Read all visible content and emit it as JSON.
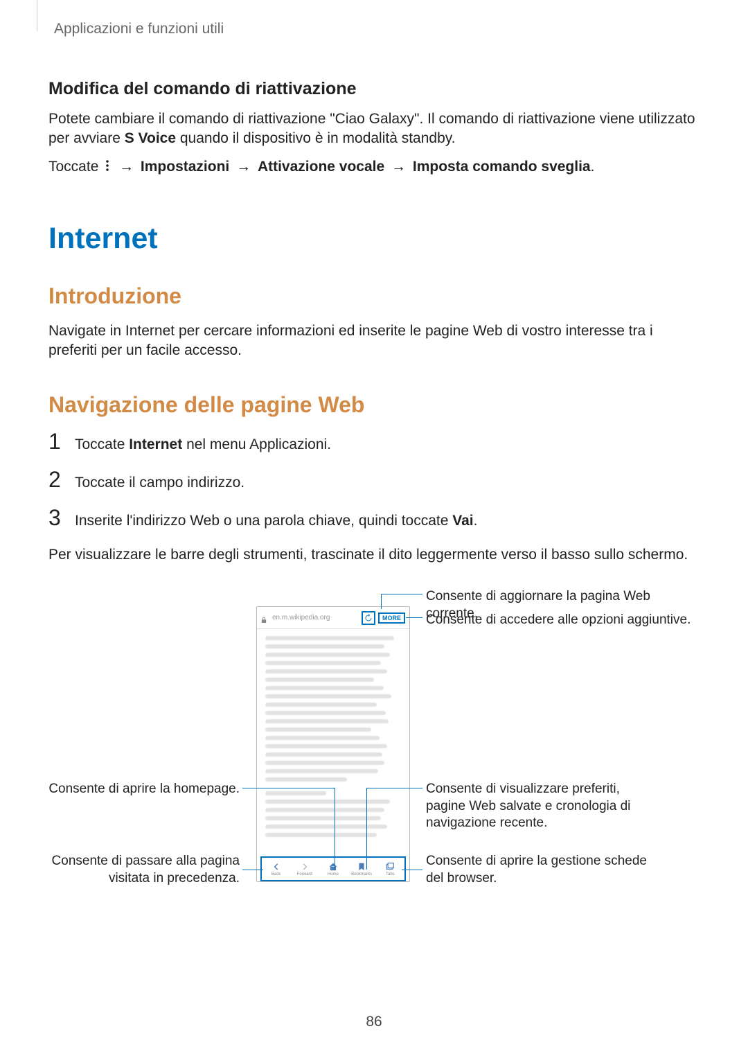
{
  "header": "Applicazioni e funzioni utili",
  "section1": {
    "title": "Modifica del comando di riattivazione",
    "p1_part1": "Potete cambiare il comando di riattivazione \"Ciao Galaxy\". Il comando di riattivazione viene utilizzato per avviare ",
    "p1_bold": "S Voice",
    "p1_part2": " quando il dispositivo è in modalità standby.",
    "p2_part1": "Toccate ",
    "p2_path1": "Impostazioni",
    "p2_path2": "Attivazione vocale",
    "p2_path3": "Imposta comando sveglia",
    "p2_end": "."
  },
  "h1": "Internet",
  "section2": {
    "title": "Introduzione",
    "p1": "Navigate in Internet per cercare informazioni ed inserite le pagine Web di vostro interesse tra i preferiti per un facile accesso."
  },
  "section3": {
    "title": "Navigazione delle pagine Web",
    "step1_part1": "Toccate ",
    "step1_bold": "Internet",
    "step1_part2": " nel menu Applicazioni.",
    "step2": "Toccate il campo indirizzo.",
    "step3_part1": "Inserite l'indirizzo Web o una parola chiave, quindi toccate ",
    "step3_bold": "Vai",
    "step3_part2": ".",
    "p_after": "Per visualizzare le barre degli strumenti, trascinate il dito leggermente verso il basso sullo schermo."
  },
  "screenshot": {
    "url": "en.m.wikipedia.org",
    "more": "MORE",
    "nav": {
      "back": "Back",
      "forward": "Forward",
      "home": "Home",
      "bookmarks": "Bookmarks",
      "tabs": "Tabs"
    }
  },
  "callouts": {
    "refresh": "Consente di aggiornare la pagina Web corrente.",
    "more": "Consente di accedere alle opzioni aggiuntive.",
    "bookmarks": "Consente di visualizzare preferiti, pagine Web salvate e cronologia di navigazione recente.",
    "tabs": "Consente di aprire la gestione schede del browser.",
    "homepage": "Consente di aprire la homepage.",
    "back": "Consente di passare alla pagina visitata in precedenza."
  },
  "page_number": "86"
}
